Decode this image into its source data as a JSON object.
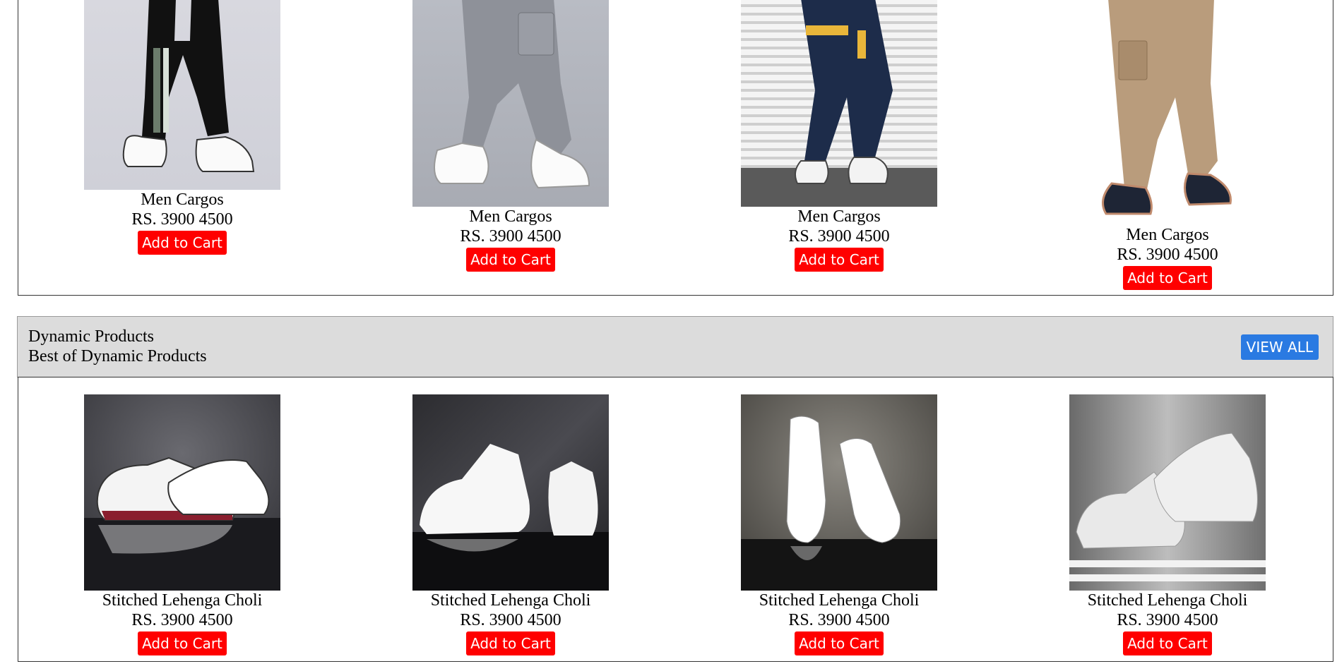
{
  "section1": {
    "products": [
      {
        "name": "Men Cargos",
        "price": "RS. 3900 4500",
        "cart_label": "Add to Cart"
      },
      {
        "name": "Men Cargos",
        "price": "RS. 3900 4500",
        "cart_label": "Add to Cart"
      },
      {
        "name": "Men Cargos",
        "price": "RS. 3900 4500",
        "cart_label": "Add to Cart"
      },
      {
        "name": "Men Cargos",
        "price": "RS. 3900 4500",
        "cart_label": "Add to Cart"
      }
    ]
  },
  "section2": {
    "title": "Dynamic Products",
    "subtitle": "Best of Dynamic Products",
    "view_all_label": "VIEW ALL",
    "products": [
      {
        "name": "Stitched Lehenga Choli",
        "price": "RS. 3900 4500",
        "cart_label": "Add to Cart"
      },
      {
        "name": "Stitched Lehenga Choli",
        "price": "RS. 3900 4500",
        "cart_label": "Add to Cart"
      },
      {
        "name": "Stitched Lehenga Choli",
        "price": "RS. 3900 4500",
        "cart_label": "Add to Cart"
      },
      {
        "name": "Stitched Lehenga Choli",
        "price": "RS. 3900 4500",
        "cart_label": "Add to Cart"
      }
    ]
  },
  "colors": {
    "cart_button": "#ff0000",
    "view_all_button": "#2a7ae2",
    "header_bg": "#dcdcdc"
  }
}
